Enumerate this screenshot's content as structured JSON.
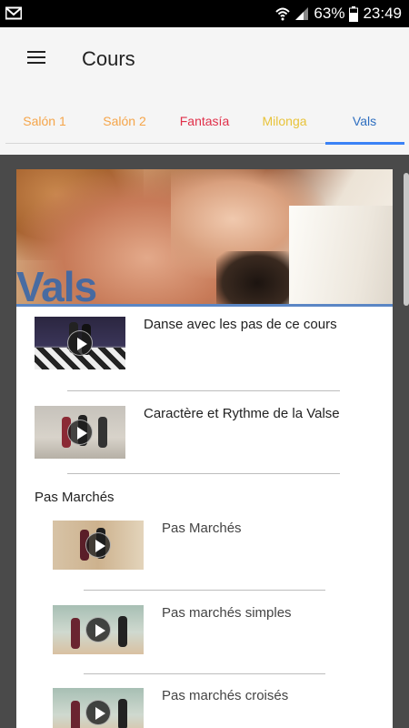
{
  "status_bar": {
    "battery": "63%",
    "time": "23:49",
    "icons": [
      "mail-icon",
      "wifi-icon",
      "signal-icon",
      "battery-icon"
    ]
  },
  "app_bar": {
    "title": "Cours",
    "menu_icon": "menu-icon"
  },
  "tabs": [
    {
      "label": "Salón 1",
      "color": "#f5a54a",
      "active": false
    },
    {
      "label": "Salón 2",
      "color": "#f5a54a",
      "active": false
    },
    {
      "label": "Fantasía",
      "color": "#e0304a",
      "active": false
    },
    {
      "label": "Milonga",
      "color": "#e8c33a",
      "active": false
    },
    {
      "label": "Vals",
      "color": "#2f6fc0",
      "active": true
    }
  ],
  "hero": {
    "label": "Vals"
  },
  "lessons": [
    {
      "label": "Danse avec les pas de ce cours"
    },
    {
      "label": "Caractère et Rythme de la Valse"
    }
  ],
  "section": {
    "title": "Pas Marchés",
    "items": [
      {
        "label": "Pas Marchés"
      },
      {
        "label": "Pas marchés simples"
      },
      {
        "label": "Pas marchés croisés"
      }
    ]
  },
  "colors": {
    "accent": "#3b82f6",
    "background": "#4a4a4a"
  }
}
